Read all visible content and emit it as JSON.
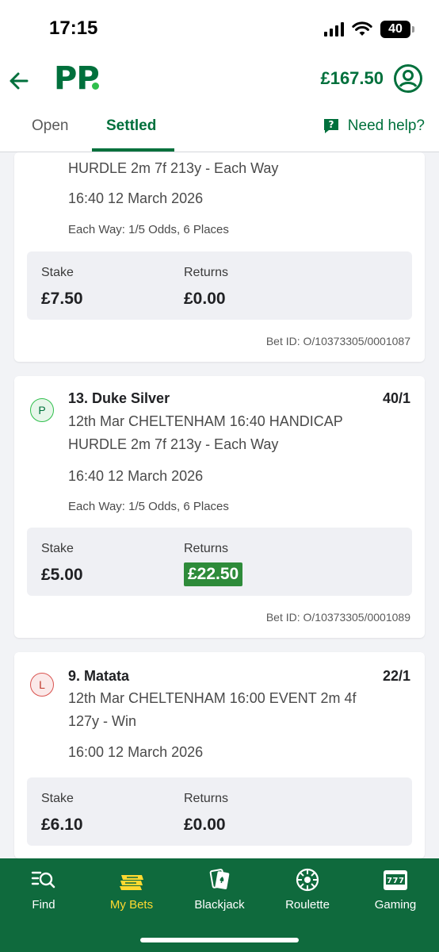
{
  "status_bar": {
    "time": "17:15",
    "battery": "40"
  },
  "header": {
    "balance": "£167.50",
    "logo_text": "PP"
  },
  "tabs": {
    "open": "Open",
    "settled": "Settled",
    "help": "Need help?"
  },
  "summary_labels": {
    "stake": "Stake",
    "returns": "Returns"
  },
  "bets": [
    {
      "market": "HURDLE 2m 7f 213y - Each Way",
      "event_time": "16:40 12 March 2026",
      "terms": "Each Way: 1/5 Odds, 6 Places",
      "stake": "£7.50",
      "returns": "£0.00",
      "bet_id": "Bet ID: O/10373305/0001087"
    },
    {
      "result": "P",
      "selection": "13. Duke Silver",
      "odds": "40/1",
      "market_line1": "12th Mar CHELTENHAM 16:40 HANDICAP",
      "market_line2": "HURDLE 2m 7f 213y - Each Way",
      "event_time": "16:40 12 March 2026",
      "terms": "Each Way: 1/5 Odds, 6 Places",
      "stake": "£5.00",
      "returns": "£22.50",
      "bet_id": "Bet ID: O/10373305/0001089"
    },
    {
      "result": "L",
      "selection": "9. Matata",
      "odds": "22/1",
      "market_line1": "12th Mar CHELTENHAM 16:00 EVENT 2m 4f",
      "market_line2": "127y - Win",
      "event_time": "16:00 12 March 2026",
      "stake": "£6.10",
      "returns": "£0.00"
    }
  ],
  "bottom_nav": [
    {
      "label": "Find",
      "icon": "search-list-icon"
    },
    {
      "label": "My Bets",
      "icon": "bet-slips-icon",
      "active": true
    },
    {
      "label": "Blackjack",
      "icon": "playing-cards-icon"
    },
    {
      "label": "Roulette",
      "icon": "roulette-wheel-icon"
    },
    {
      "label": "Gaming",
      "icon": "slot-machine-icon"
    }
  ],
  "colors": {
    "brand_green": "#00703c",
    "nav_background": "#0f6a3d",
    "active_nav": "#ffd930",
    "win_highlight": "#2e8b3a",
    "placed_badge": "#2fbf4c",
    "lost_badge": "#d9534f"
  }
}
